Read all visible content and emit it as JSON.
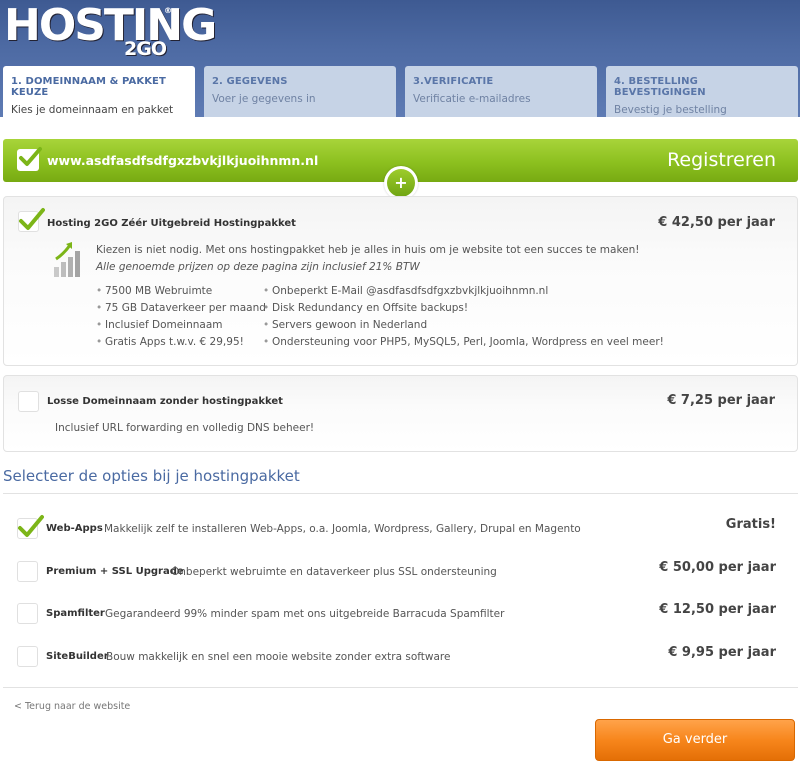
{
  "logo": {
    "main": "HOSTING",
    "sub": "2GO",
    "reg": "®"
  },
  "tabs": [
    {
      "title": "1. DOMEINNAAM & PAKKET KEUZE",
      "sub": "Kies je domeinnaam en pakket",
      "active": true
    },
    {
      "title": "2. GEGEVENS",
      "sub": "Voer je gegevens in",
      "active": false
    },
    {
      "title": "3.VERIFICATIE",
      "sub": "Verificatie e-mailadres",
      "active": false
    },
    {
      "title": "4. BESTELLING BEVESTIGINGEN",
      "sub": "Bevestig je bestelling",
      "active": false
    }
  ],
  "domain": {
    "name": "www.asdfasdfsdfgxzbvkjlkjuoihnmn.nl",
    "action": "Registreren",
    "plus": "+"
  },
  "package1": {
    "title": "Hosting 2GO Zéér Uitgebreid Hostingpakket",
    "price": "€ 42,50 per jaar",
    "desc": "Kiezen is niet nodig. Met ons hostingpakket heb je alles in huis om je website tot een succes te maken!",
    "note": "Alle genoemde prijzen op deze pagina zijn inclusief 21% BTW",
    "features_left": [
      "7500 MB Webruimte",
      "75 GB Dataverkeer per maand",
      "Inclusief Domeinnaam",
      "Gratis Apps t.w.v. € 29,95!"
    ],
    "features_right": [
      "Onbeperkt E-Mail @asdfasdfsdfgxzbvkjlkjuoihnmn.nl",
      "Disk Redundancy en Offsite backups!",
      "Servers gewoon in Nederland",
      "Ondersteuning voor PHP5, MySQL5, Perl, Joomla, Wordpress en veel meer!"
    ]
  },
  "package2": {
    "title": "Losse Domeinnaam zonder hostingpakket",
    "price": "€ 7,25 per jaar",
    "desc": "Inclusief URL forwarding en volledig DNS beheer!"
  },
  "options_title": "Selecteer de opties bij je hostingpakket",
  "options": [
    {
      "name": "Web-Apps",
      "desc": "Makkelijk zelf te installeren Web-Apps, o.a. Joomla, Wordpress, Gallery, Drupal en Magento",
      "price": "Gratis!",
      "checked": true
    },
    {
      "name": "Premium + SSL Upgrade",
      "desc": "Onbeperkt webruimte en dataverkeer plus SSL ondersteuning",
      "price": "€ 50,00 per jaar",
      "checked": false
    },
    {
      "name": "Spamfilter",
      "desc": "Gegarandeerd 99% minder spam met ons uitgebreide Barracuda Spamfilter",
      "price": "€ 12,50 per jaar",
      "checked": false
    },
    {
      "name": "SiteBuilder",
      "desc": "Bouw makkelijk en snel een mooie website zonder extra software",
      "price": "€ 9,95 per jaar",
      "checked": false
    }
  ],
  "back_link": "< Terug naar de website",
  "next_button": "Ga verder",
  "colors": {
    "header": "#4d6aa3",
    "green": "#8cc01f",
    "orange": "#f7861c",
    "accent_text": "#4a6aa2"
  },
  "icons": {
    "check": "checkmark-icon",
    "chart": "growth-chart-icon",
    "plus": "plus-icon"
  }
}
